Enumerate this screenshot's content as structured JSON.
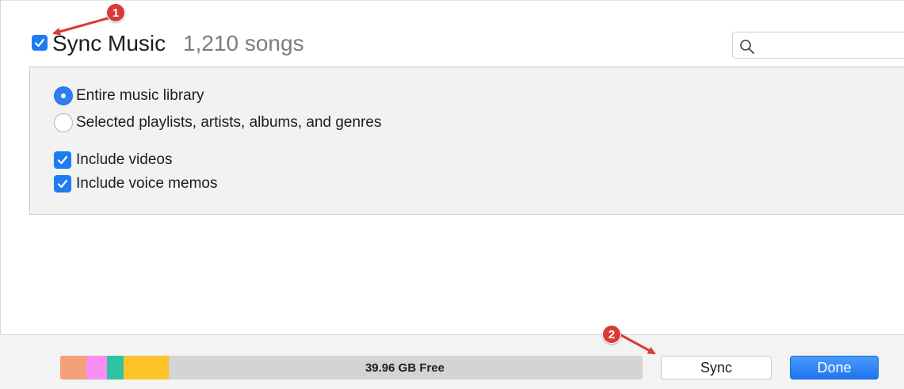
{
  "header": {
    "sync_checked": true,
    "title": "Sync Music",
    "song_count": "1,210 songs",
    "search_placeholder": "",
    "search_icon": "search-icon"
  },
  "options": {
    "radios": [
      {
        "label": "Entire music library",
        "selected": true
      },
      {
        "label": "Selected playlists, artists, albums, and genres",
        "selected": false
      }
    ],
    "checkboxes": [
      {
        "label": "Include videos",
        "checked": true
      },
      {
        "label": "Include voice memos",
        "checked": true
      }
    ]
  },
  "storage": {
    "free_label": "39.96 GB Free",
    "segment_colors": [
      "#f4a07a",
      "#f98ef4",
      "#2fc2a2",
      "#fdc32a",
      "#d4d4d4"
    ]
  },
  "buttons": {
    "sync_label": "Sync",
    "done_label": "Done"
  },
  "annotations": {
    "badge_1": "1",
    "badge_2": "2",
    "color": "#d93a35"
  },
  "colors": {
    "accent": "#1e7cf2",
    "panel": "#f2f2f2"
  }
}
